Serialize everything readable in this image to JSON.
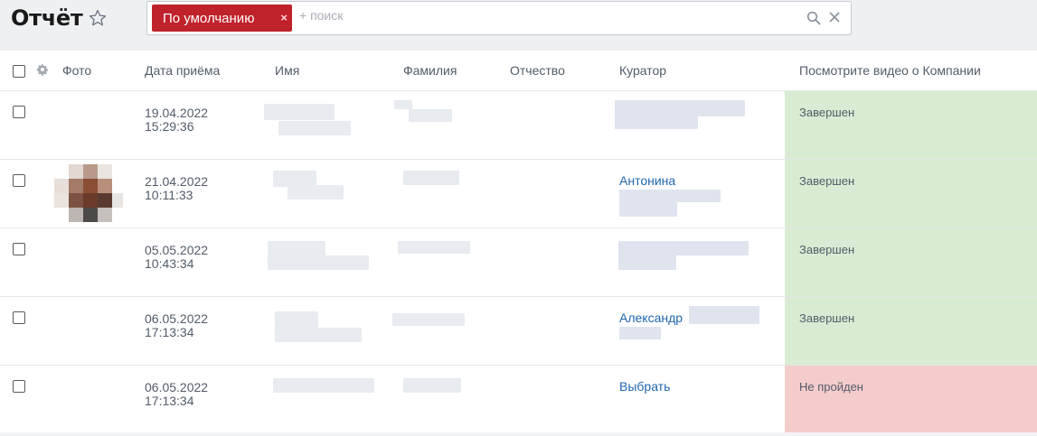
{
  "page": {
    "title": "Отчёт"
  },
  "filter": {
    "chip_label": "По умолчанию",
    "chip_close": "×",
    "search_placeholder": "+ поиск"
  },
  "table": {
    "columns": [
      "Фото",
      "Дата приёма",
      "Имя",
      "Фамилия",
      "Отчество",
      "Куратор",
      "Посмотрите видео о Компании"
    ],
    "rows": [
      {
        "date": "19.04.2022",
        "time": "15:29:36",
        "curator": "",
        "status": "Завершен"
      },
      {
        "date": "21.04.2022",
        "time": "10:11:33",
        "curator": "Антонина",
        "status": "Завершен"
      },
      {
        "date": "05.05.2022",
        "time": "10:43:34",
        "curator": "",
        "status": "Завершен"
      },
      {
        "date": "06.05.2022",
        "time": "17:13:34",
        "curator": "Александр",
        "status": "Завершен"
      },
      {
        "date": "06.05.2022",
        "time": "17:13:34",
        "curator": "Выбрать",
        "status": "Не пройден"
      }
    ]
  },
  "colors": {
    "accent": "#c0222b",
    "link": "#2067b0",
    "status_done": "#d9ebd2",
    "status_failed": "#f4cccc"
  }
}
